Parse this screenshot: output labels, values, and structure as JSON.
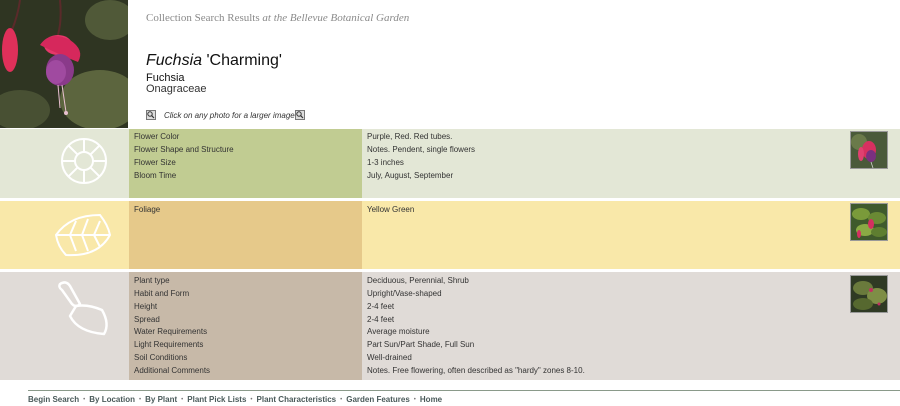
{
  "header": {
    "title_plain": "Collection Search Results",
    "title_italic": "at the Bellevue Botanical Garden",
    "sci_name_genus": "Fuchsia",
    "sci_name_cultivar": "'Charming'",
    "common_name": "Fuchsia",
    "family": "Onagraceae",
    "photo_hint": "Click on any photo for a larger image"
  },
  "flower": {
    "icon": "flower-icon",
    "rows": [
      {
        "label": "Flower Color",
        "value": "Purple, Red.  Red tubes."
      },
      {
        "label": "Flower Shape and Structure",
        "value": "Notes. Pendent, single flowers"
      },
      {
        "label": "Flower Size",
        "value": "1-3 inches"
      },
      {
        "label": "Bloom Time",
        "value": "July, August, September"
      }
    ]
  },
  "foliage": {
    "icon": "leaf-icon",
    "rows": [
      {
        "label": "Foliage",
        "value": "Yellow Green"
      }
    ]
  },
  "plant": {
    "icon": "trowel-icon",
    "rows": [
      {
        "label": "Plant type",
        "value": "Deciduous, Perennial, Shrub"
      },
      {
        "label": "Habit and Form",
        "value": "Upright/Vase-shaped"
      },
      {
        "label": "Height",
        "value": "2-4 feet"
      },
      {
        "label": "Spread",
        "value": "2-4 feet"
      },
      {
        "label": "Water Requirements",
        "value": "Average moisture"
      },
      {
        "label": "Light Requirements",
        "value": "Part Sun/Part Shade, Full Sun"
      },
      {
        "label": "Soil Conditions",
        "value": "Well-drained"
      },
      {
        "label": "Additional Comments",
        "value": "Notes. Free flowering, often described as \"hardy\" zones 8-10."
      }
    ]
  },
  "footer": {
    "links": [
      "Begin Search",
      "By Location",
      "By Plant",
      "Plant Pick Lists",
      "Plant Characteristics",
      "Garden Features",
      "Home"
    ]
  },
  "colors": {
    "flower_icon_bg": "#e3e7d6",
    "flower_label_bg": "#c1cc92",
    "flower_value_bg": "#e3e7d6",
    "foliage_icon_bg": "#f9e8a9",
    "foliage_label_bg": "#e6c98a",
    "foliage_value_bg": "#f9e8a9",
    "plant_icon_bg": "#e0dbd7",
    "plant_label_bg": "#c7b9a8",
    "plant_value_bg": "#e0dbd7"
  }
}
